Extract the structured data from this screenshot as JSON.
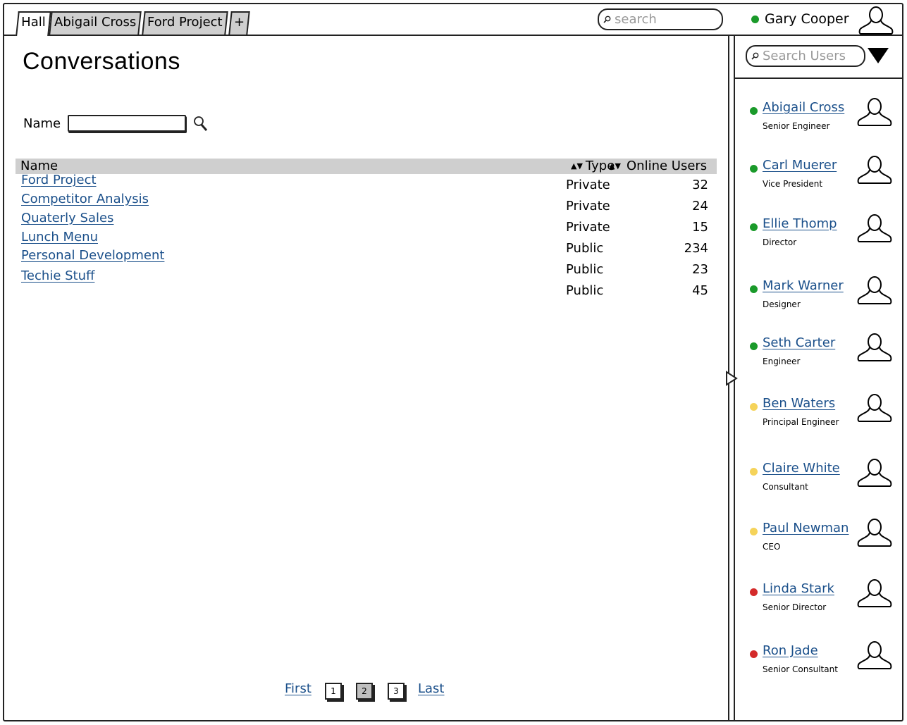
{
  "tabs": [
    {
      "label": "Hall",
      "active": true
    },
    {
      "label": "Abigail Cross",
      "active": false
    },
    {
      "label": "Ford Project",
      "active": false
    },
    {
      "label": "+",
      "active": false
    }
  ],
  "header": {
    "search_placeholder": "search",
    "current_user": {
      "name": "Gary Cooper",
      "status": "online"
    }
  },
  "main": {
    "title": "Conversations",
    "filter": {
      "label": "Name",
      "value": ""
    },
    "table": {
      "columns": [
        "Name",
        "Type",
        "Online Users"
      ],
      "rows": [
        {
          "name": "Ford Project",
          "type": "Private",
          "online": "32"
        },
        {
          "name": "Competitor Analysis",
          "type": "Private",
          "online": "24"
        },
        {
          "name": "Quaterly Sales",
          "type": "Private",
          "online": "15"
        },
        {
          "name": "Lunch Menu",
          "type": "Public",
          "online": "234"
        },
        {
          "name": "Personal Development",
          "type": "Public",
          "online": "23"
        },
        {
          "name": "Techie Stuff",
          "type": "Public",
          "online": "45"
        }
      ]
    },
    "pagination": {
      "first": "First",
      "pages": [
        "1",
        "2",
        "3"
      ],
      "current": "2",
      "last": "Last"
    }
  },
  "sidebar": {
    "search_placeholder": "Search Users",
    "status_colors": {
      "online": "#1a9a2a",
      "away": "#f5d35a",
      "busy": "#d42a2a"
    },
    "users": [
      {
        "name": "Abigail Cross",
        "role": "Senior Engineer",
        "status": "online"
      },
      {
        "name": "Carl Muerer",
        "role": "Vice President",
        "status": "online"
      },
      {
        "name": "Ellie Thomp",
        "role": "Director",
        "status": "online"
      },
      {
        "name": "Mark Warner",
        "role": "Designer",
        "status": "online"
      },
      {
        "name": "Seth Carter",
        "role": "Engineer",
        "status": "online"
      },
      {
        "name": "Ben Waters",
        "role": "Principal Engineer",
        "status": "away"
      },
      {
        "name": "Claire White",
        "role": "Consultant",
        "status": "away"
      },
      {
        "name": "Paul Newman",
        "role": "CEO",
        "status": "away"
      },
      {
        "name": "Linda Stark",
        "role": "Senior Director",
        "status": "busy"
      },
      {
        "name": "Ron Jade",
        "role": "Senior Consultant",
        "status": "busy"
      }
    ]
  }
}
